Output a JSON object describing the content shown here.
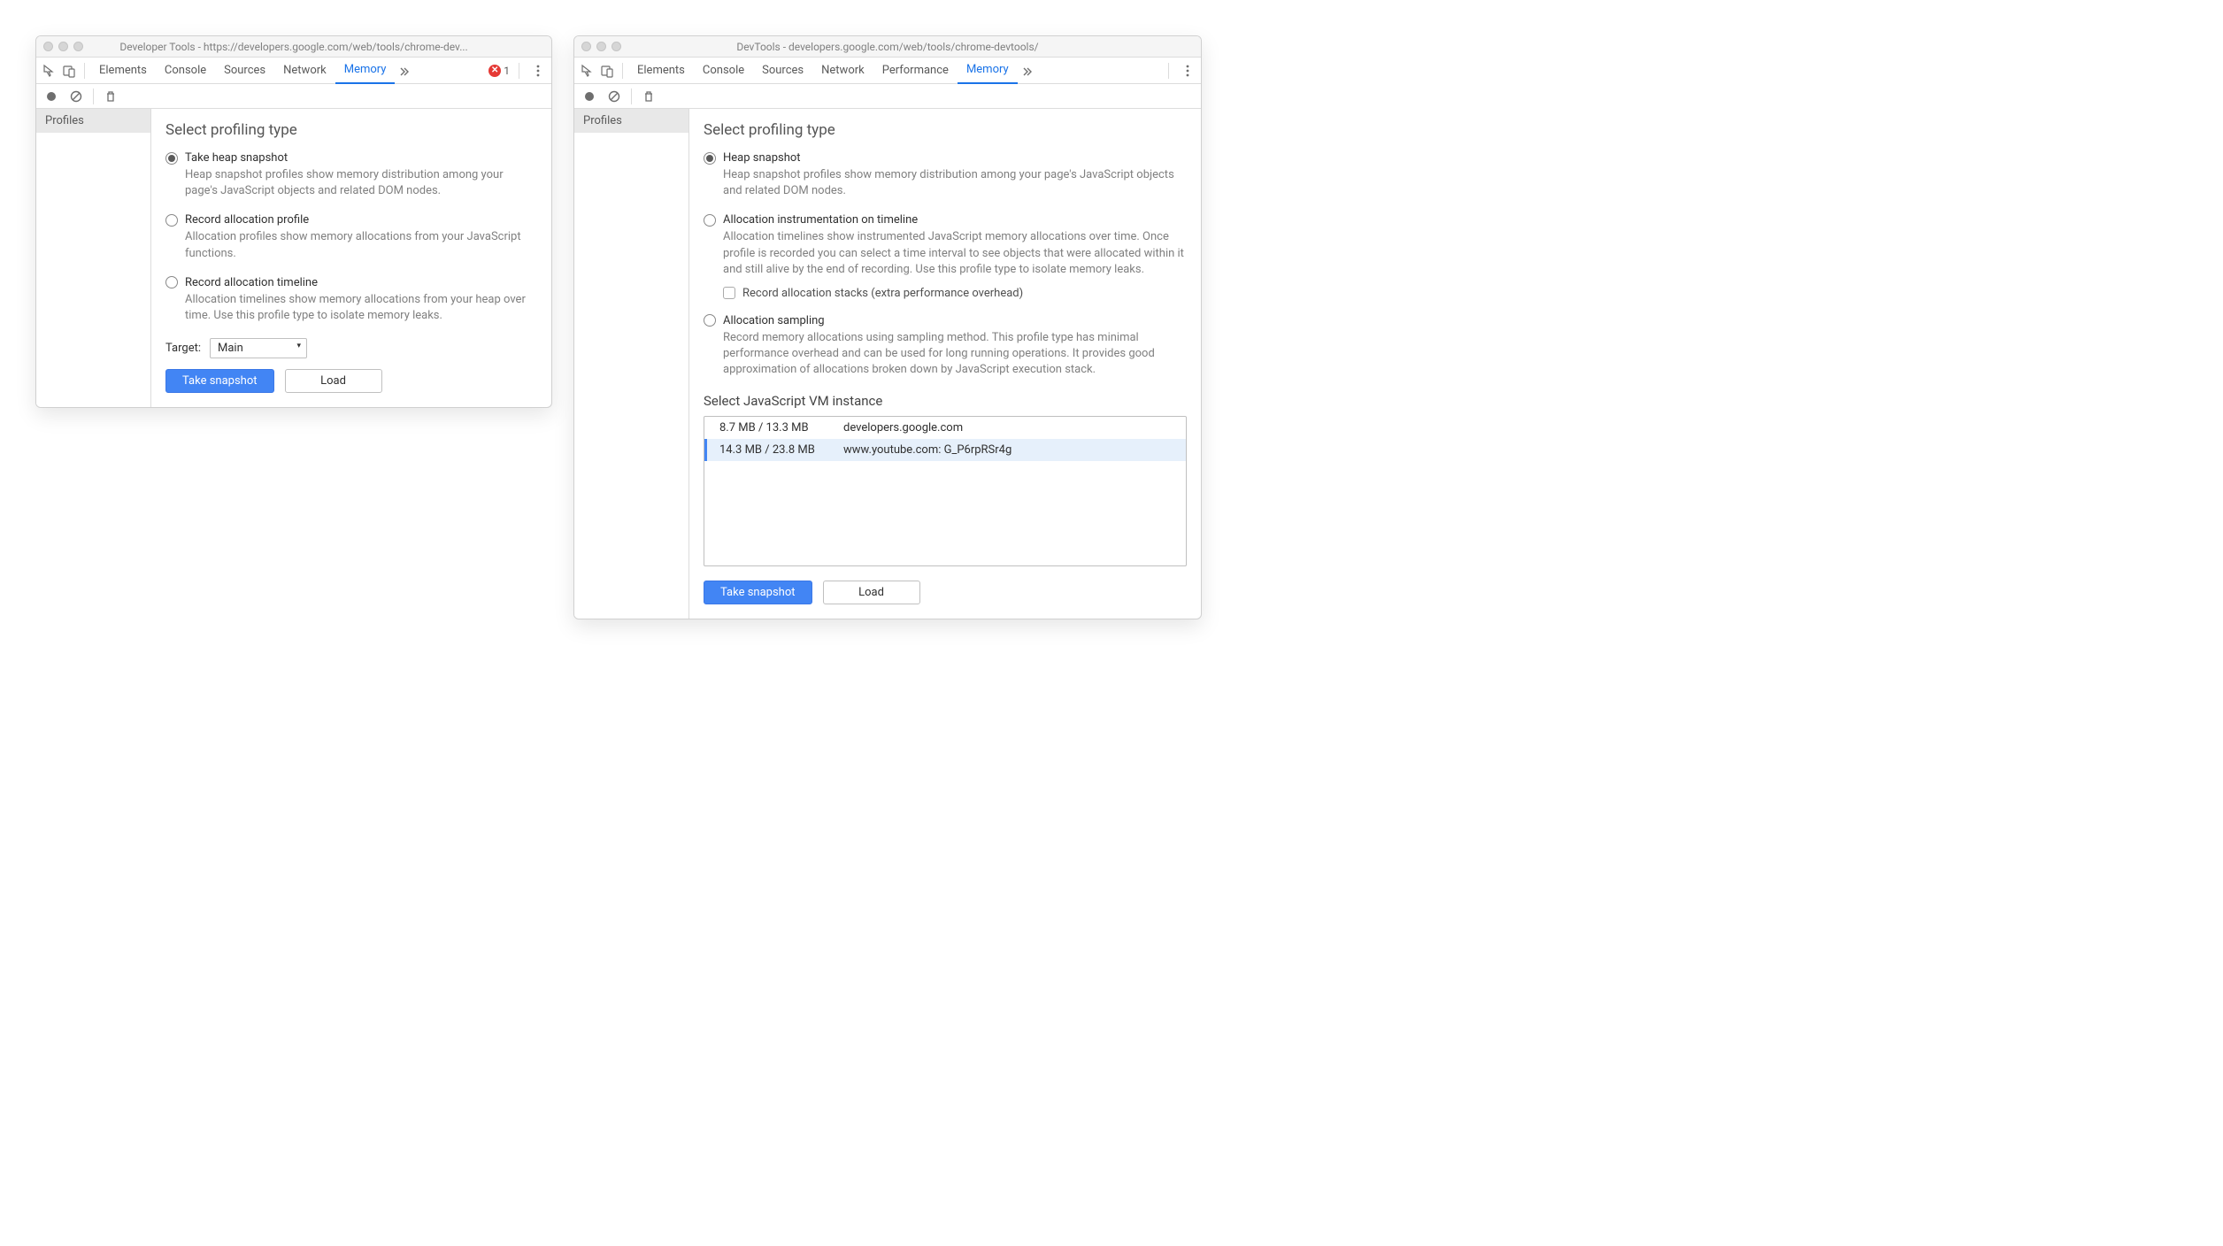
{
  "window1": {
    "title": "Developer Tools - https://developers.google.com/web/tools/chrome-dev...",
    "tabs": [
      "Elements",
      "Console",
      "Sources",
      "Network",
      "Memory"
    ],
    "active_tab": "Memory",
    "error_count": "1",
    "sidebar": {
      "profiles_label": "Profiles"
    },
    "main": {
      "title": "Select profiling type",
      "options": [
        {
          "title": "Take heap snapshot",
          "desc": "Heap snapshot profiles show memory distribution among your page's JavaScript objects and related DOM nodes.",
          "checked": true
        },
        {
          "title": "Record allocation profile",
          "desc": "Allocation profiles show memory allocations from your JavaScript functions.",
          "checked": false
        },
        {
          "title": "Record allocation timeline",
          "desc": "Allocation timelines show memory allocations from your heap over time. Use this profile type to isolate memory leaks.",
          "checked": false
        }
      ],
      "target_label": "Target:",
      "target_value": "Main",
      "take_snapshot_label": "Take snapshot",
      "load_label": "Load"
    }
  },
  "window2": {
    "title": "DevTools - developers.google.com/web/tools/chrome-devtools/",
    "tabs": [
      "Elements",
      "Console",
      "Sources",
      "Network",
      "Performance",
      "Memory"
    ],
    "active_tab": "Memory",
    "sidebar": {
      "profiles_label": "Profiles"
    },
    "main": {
      "title": "Select profiling type",
      "options": [
        {
          "title": "Heap snapshot",
          "desc": "Heap snapshot profiles show memory distribution among your page's JavaScript objects and related DOM nodes.",
          "checked": true
        },
        {
          "title": "Allocation instrumentation on timeline",
          "desc": "Allocation timelines show instrumented JavaScript memory allocations over time. Once profile is recorded you can select a time interval to see objects that were allocated within it and still alive by the end of recording. Use this profile type to isolate memory leaks.",
          "checked": false,
          "sub_checkbox_label": "Record allocation stacks (extra performance overhead)"
        },
        {
          "title": "Allocation sampling",
          "desc": "Record memory allocations using sampling method. This profile type has minimal performance overhead and can be used for long running operations. It provides good approximation of allocations broken down by JavaScript execution stack.",
          "checked": false
        }
      ],
      "vm_section_title": "Select JavaScript VM instance",
      "vm_instances": [
        {
          "size": "8.7 MB / 13.3 MB",
          "origin": "developers.google.com",
          "selected": false
        },
        {
          "size": "14.3 MB / 23.8 MB",
          "origin": "www.youtube.com: G_P6rpRSr4g",
          "selected": true
        }
      ],
      "take_snapshot_label": "Take snapshot",
      "load_label": "Load"
    }
  }
}
